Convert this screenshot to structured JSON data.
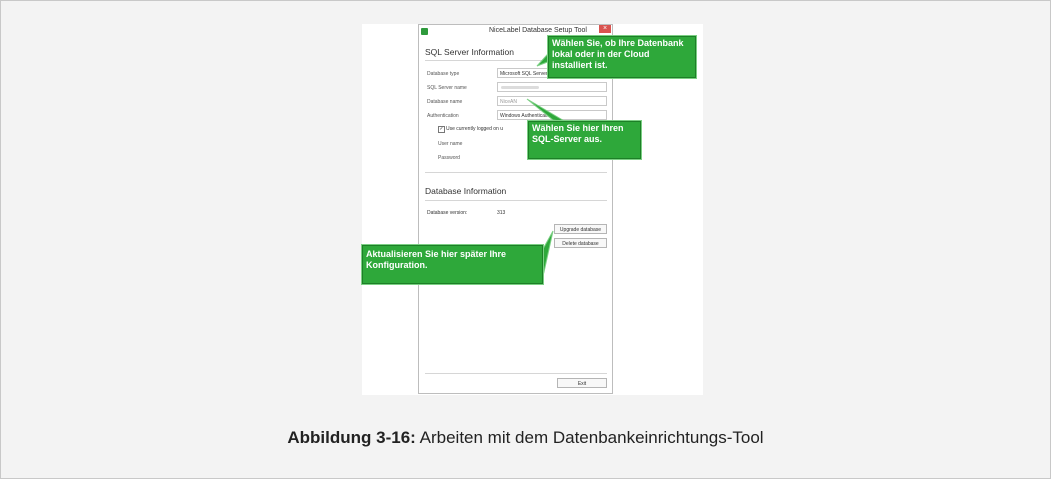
{
  "window": {
    "title": "NiceLabel Database Setup Tool",
    "close_glyph": "×"
  },
  "sql_server": {
    "heading": "SQL Server Information",
    "database_type_label": "Database type",
    "database_type_value": "Microsoft SQL Server",
    "sql_server_name_label": "SQL Server name",
    "database_name_label": "Database name",
    "database_name_value": "NiceAN",
    "authentication_label": "Authentication",
    "authentication_value": "Windows Authentication",
    "use_current_user_label": "Use currently logged on u",
    "use_current_user_checked": true,
    "user_name_label": "User name",
    "password_label": "Password"
  },
  "database_info": {
    "heading": "Database Information",
    "version_label": "Database version:",
    "version_value": "313",
    "upgrade_button": "Upgrade database",
    "delete_button": "Delete database"
  },
  "footer": {
    "exit_button": "Exit"
  },
  "callouts": {
    "database_location": "Wählen Sie, ob Ihre Datenbank lokal oder in der Cloud installiert ist.",
    "sql_server": "Wählen Sie hier Ihren SQL-Server aus.",
    "update_config": "Aktualisieren Sie hier später Ihre Konfiguration."
  },
  "caption": {
    "label": "Abbildung 3-16:",
    "text": " Arbeiten mit dem Datenbankeinrichtungs-Tool"
  },
  "colors": {
    "callout_green": "#2ea83a",
    "close_red": "#d9534f"
  }
}
